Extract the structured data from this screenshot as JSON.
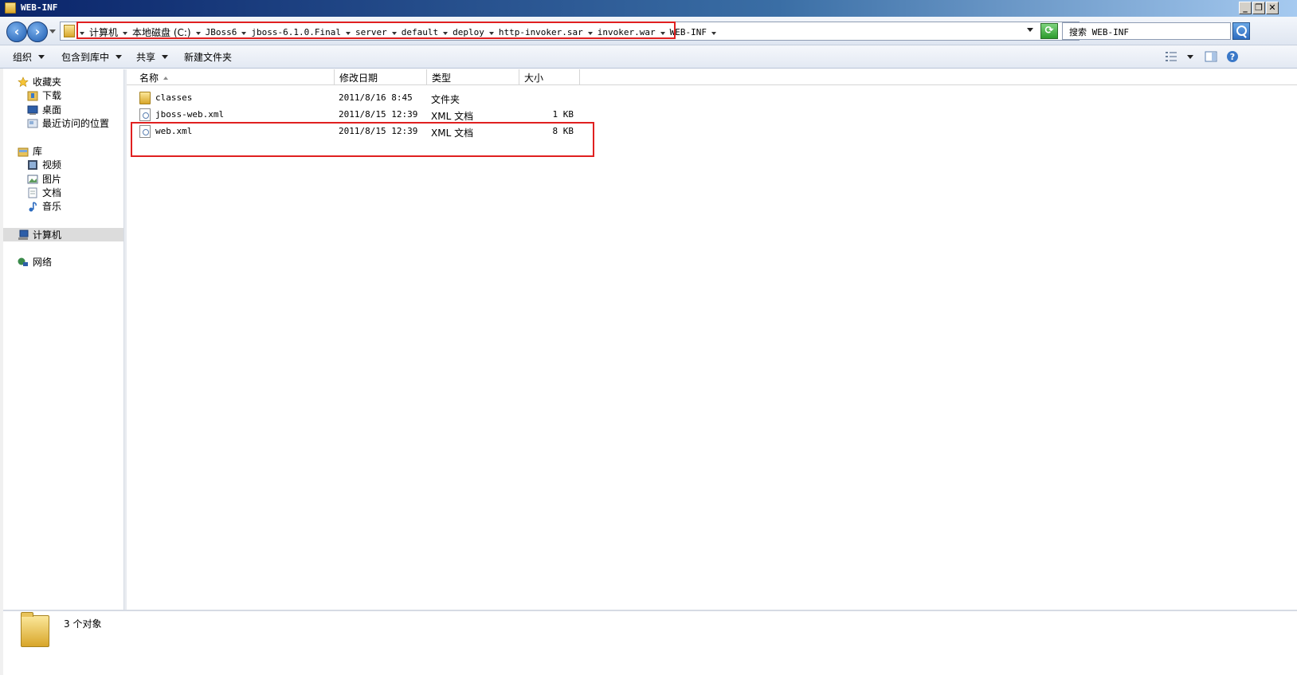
{
  "window": {
    "title": "WEB-INF"
  },
  "address": {
    "crumbs": [
      "计算机",
      "本地磁盘 (C:)",
      "JBoss6",
      "jboss-6.1.0.Final",
      "server",
      "default",
      "deploy",
      "http-invoker.sar",
      "invoker.war",
      "WEB-INF"
    ]
  },
  "search": {
    "placeholder": "搜索 WEB-INF"
  },
  "toolbar": {
    "organize": "组织",
    "include_in_library": "包含到库中",
    "share": "共享",
    "new_folder": "新建文件夹"
  },
  "sidebar": {
    "favorites": "收藏夹",
    "downloads": "下载",
    "desktop": "桌面",
    "recent": "最近访问的位置",
    "libraries": "库",
    "videos": "视频",
    "pictures": "图片",
    "documents": "文档",
    "music": "音乐",
    "computer": "计算机",
    "network": "网络"
  },
  "columns": {
    "name": "名称",
    "modified": "修改日期",
    "type": "类型",
    "size": "大小"
  },
  "files": [
    {
      "name": "classes",
      "modified": "2011/8/16 8:45",
      "type": "文件夹",
      "size": "",
      "icon": "folder-icon"
    },
    {
      "name": "jboss-web.xml",
      "modified": "2011/8/15 12:39",
      "type": "XML 文档",
      "size": "1 KB",
      "icon": "xml-file-icon"
    },
    {
      "name": "web.xml",
      "modified": "2011/8/15 12:39",
      "type": "XML 文档",
      "size": "8 KB",
      "icon": "xml-file-icon"
    }
  ],
  "status": {
    "item_count": "3 个对象"
  },
  "colors": {
    "highlight": "#e02020",
    "titlebar": "#0a246a"
  }
}
